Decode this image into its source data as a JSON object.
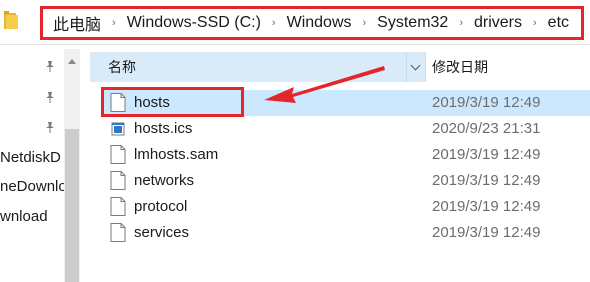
{
  "address_bar": {
    "breadcrumbs": [
      "此电脑",
      "Windows-SSD (C:)",
      "Windows",
      "System32",
      "drivers",
      "etc"
    ],
    "separator": "›"
  },
  "nav": {
    "items": [
      "NetdiskD",
      "neDownlo",
      "wnload"
    ]
  },
  "columns": {
    "name": "名称",
    "date": "修改日期"
  },
  "files": [
    {
      "name": "hosts",
      "date": "2019/3/19 12:49",
      "icon": "file-icon",
      "selected": true
    },
    {
      "name": "hosts.ics",
      "date": "2020/9/23 21:31",
      "icon": "ics-file-icon",
      "selected": false
    },
    {
      "name": "lmhosts.sam",
      "date": "2019/3/19 12:49",
      "icon": "file-icon",
      "selected": false
    },
    {
      "name": "networks",
      "date": "2019/3/19 12:49",
      "icon": "file-icon",
      "selected": false
    },
    {
      "name": "protocol",
      "date": "2019/3/19 12:49",
      "icon": "file-icon",
      "selected": false
    },
    {
      "name": "services",
      "date": "2019/3/19 12:49",
      "icon": "file-icon",
      "selected": false
    }
  ],
  "colors": {
    "highlight": "#e3262b",
    "header_bg": "#d9ebf9",
    "selection_bg": "#cce8ff"
  }
}
